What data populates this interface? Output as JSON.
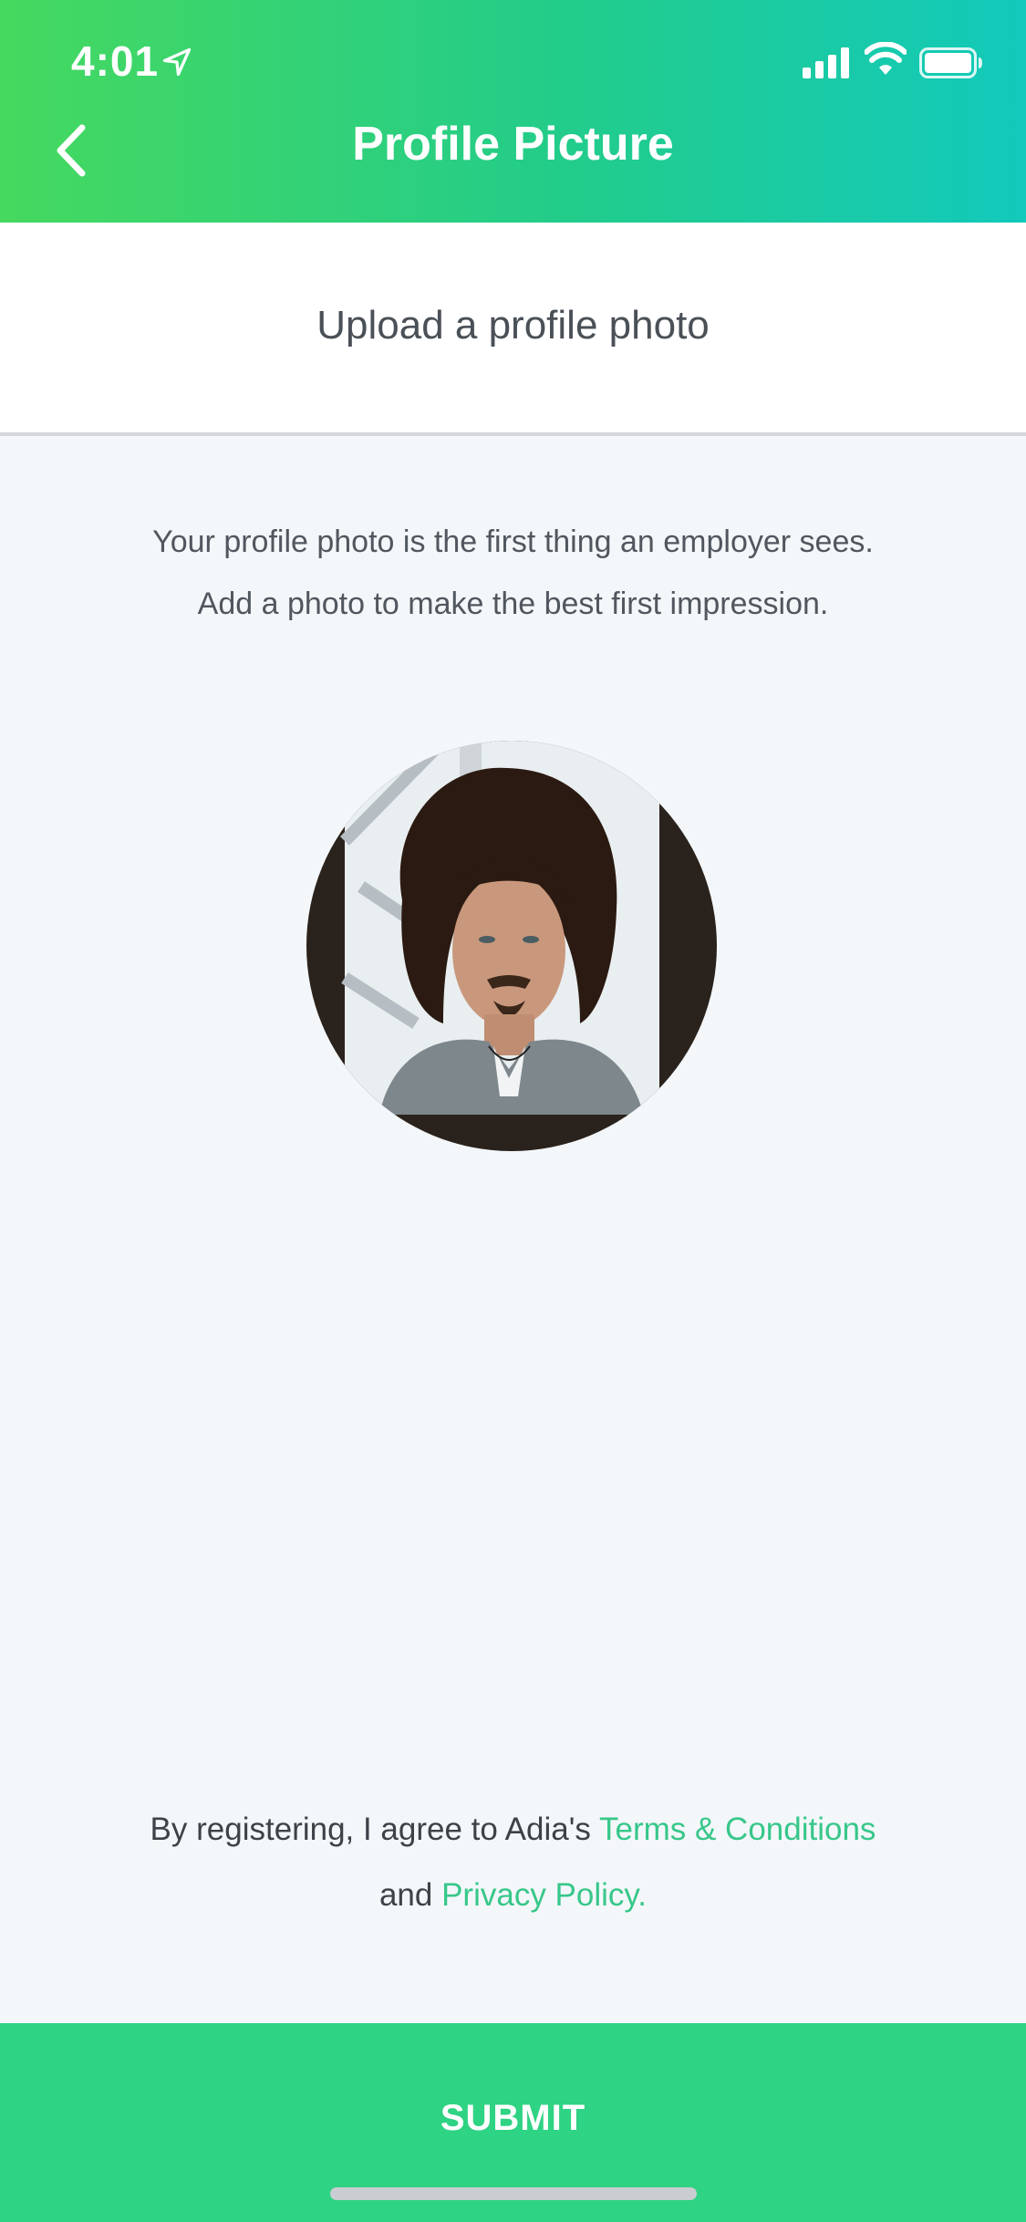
{
  "status_bar": {
    "time": "4:01",
    "icons": [
      "location-arrow-icon",
      "cellular-signal-icon",
      "wifi-icon",
      "battery-icon"
    ]
  },
  "header": {
    "title": "Profile Picture",
    "back_icon": "chevron-left-icon",
    "gradient": [
      "#46d95f",
      "#22cc8a",
      "#12c9bb"
    ]
  },
  "section": {
    "title": "Upload a profile photo"
  },
  "description": {
    "line1": "Your profile photo is the first thing an employer sees.",
    "line2": "Add a photo to make the best first impression."
  },
  "avatar": {
    "subject": "profile-photo"
  },
  "terms": {
    "prefix": "By registering, I agree to Adia's ",
    "terms_link": "Terms & Conditions",
    "middle": "and ",
    "privacy_link": "Privacy Policy.",
    "link_color": "#38c78a"
  },
  "submit": {
    "label": "SUBMIT",
    "color": "#2ed383"
  }
}
